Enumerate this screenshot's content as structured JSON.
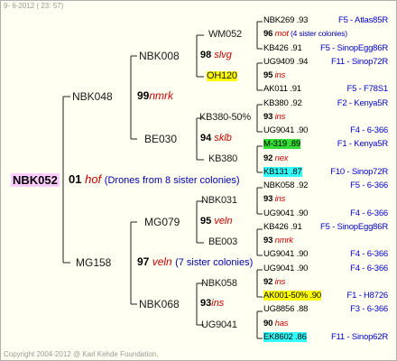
{
  "header": {
    "date": "9-  6-2012 ( 23: 57)"
  },
  "footer": {
    "copyright": "Copyright 2004-2012 @ Karl Kehde Foundation."
  },
  "root": {
    "name": "NBK052",
    "year": "01",
    "code": "hof",
    "note": "(Drones from 8 sister colonies)"
  },
  "gen1": {
    "sire": "NBK048",
    "dam": "MG158"
  },
  "gen2": [
    {
      "name": "NBK008"
    },
    {
      "name": "BE030"
    },
    {
      "name": "MG079"
    },
    {
      "name": "NBK068"
    }
  ],
  "gen2m": [
    {
      "year": "99",
      "code": "nmrk"
    },
    {
      "year": "97",
      "code": "veln",
      "note": "(7 sister colonies)"
    }
  ],
  "gen3": [
    "WM052",
    "OH120",
    "KB380-50%",
    "KB380",
    "NBK031",
    "BE003",
    "NBK058",
    "UG9041"
  ],
  "gen3m": [
    {
      "year": "98",
      "code": "slvg"
    },
    {
      "year": "94",
      "code": "sklb"
    },
    {
      "year": "95",
      "code": "veln"
    },
    {
      "year": "93",
      "code": "ins"
    }
  ],
  "gen4": [
    {
      "left": "NBK269 .93",
      "right": "F5 - Atlas85R",
      "hl": ""
    },
    {
      "left_num": "96",
      "left_code": "mot",
      "left_note": "(4 sister colonies)",
      "right": "",
      "hl": ""
    },
    {
      "left": "KB426 .91",
      "right": "F5 - SinopEgg86R",
      "hl": ""
    },
    {
      "left": "UG9409 .94",
      "right": "F11 - Sinop72R",
      "hl": ""
    },
    {
      "left_num": "95",
      "left_code": "ins",
      "right": "",
      "hl": ""
    },
    {
      "left": "AK011 .91",
      "right": "F5 - F78S1",
      "hl": ""
    },
    {
      "left": "KB380 .92",
      "right": "F2 - Kenya5R",
      "hl": ""
    },
    {
      "left_num": "93",
      "left_code": "ins",
      "right": "",
      "hl": ""
    },
    {
      "left": "UG9041 .90",
      "right": "F4 - 6-366",
      "hl": ""
    },
    {
      "left": "M-319 .89",
      "right": "F1 - Kenya5R",
      "hl": "g"
    },
    {
      "left_num": "92",
      "left_code": "nex",
      "right": "",
      "hl": ""
    },
    {
      "left": "KB131 .87",
      "right": "F10 - Sinop72R",
      "hl": "c"
    },
    {
      "left": "NBK058 .92",
      "right": "F5 - 6-366",
      "hl": ""
    },
    {
      "left_num": "93",
      "left_code": "ins",
      "right": "",
      "hl": ""
    },
    {
      "left": "UG9041 .90",
      "right": "F4 - 6-366",
      "hl": ""
    },
    {
      "left": "KB426 .91",
      "right": "F5 - SinopEgg86R",
      "hl": ""
    },
    {
      "left_num": "93",
      "left_code": "nmrk",
      "right": "",
      "hl": ""
    },
    {
      "left": "UG9041 .90",
      "right": "F4 - 6-366",
      "hl": ""
    },
    {
      "left": "UG9041 .90",
      "right": "F4 - 6-366",
      "hl": ""
    },
    {
      "left_num": "92",
      "left_code": "ins",
      "right": "",
      "hl": ""
    },
    {
      "left": "AK001-50% .90",
      "right": "F1 - H8726",
      "hl": "y"
    },
    {
      "left": "UG8856 .88",
      "right": "F3 - 6-366",
      "hl": ""
    },
    {
      "left_num": "90",
      "left_code": "has",
      "right": "",
      "hl": ""
    },
    {
      "left": "EK8602 .86",
      "right": "F11 - Sinop62R",
      "hl": "c"
    }
  ]
}
